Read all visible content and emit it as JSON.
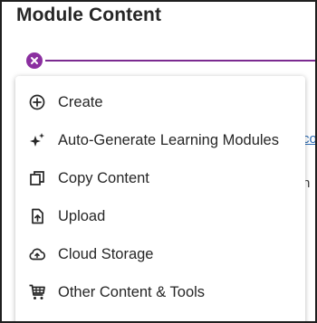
{
  "page": {
    "title": "Module Content"
  },
  "background_fragments": {
    "link_fragment": "co",
    "text_fragment": "n"
  },
  "menu": {
    "items": [
      {
        "label": "Create",
        "icon": "plus-circle-icon"
      },
      {
        "label": "Auto-Generate Learning Modules",
        "icon": "sparkle-icon"
      },
      {
        "label": "Copy Content",
        "icon": "copy-icon"
      },
      {
        "label": "Upload",
        "icon": "upload-icon"
      },
      {
        "label": "Cloud Storage",
        "icon": "cloud-icon"
      },
      {
        "label": "Other Content & Tools",
        "icon": "cart-icon"
      }
    ]
  },
  "colors": {
    "accent": "#8b2fa0",
    "text": "#262626",
    "link": "#2a6ab3"
  }
}
